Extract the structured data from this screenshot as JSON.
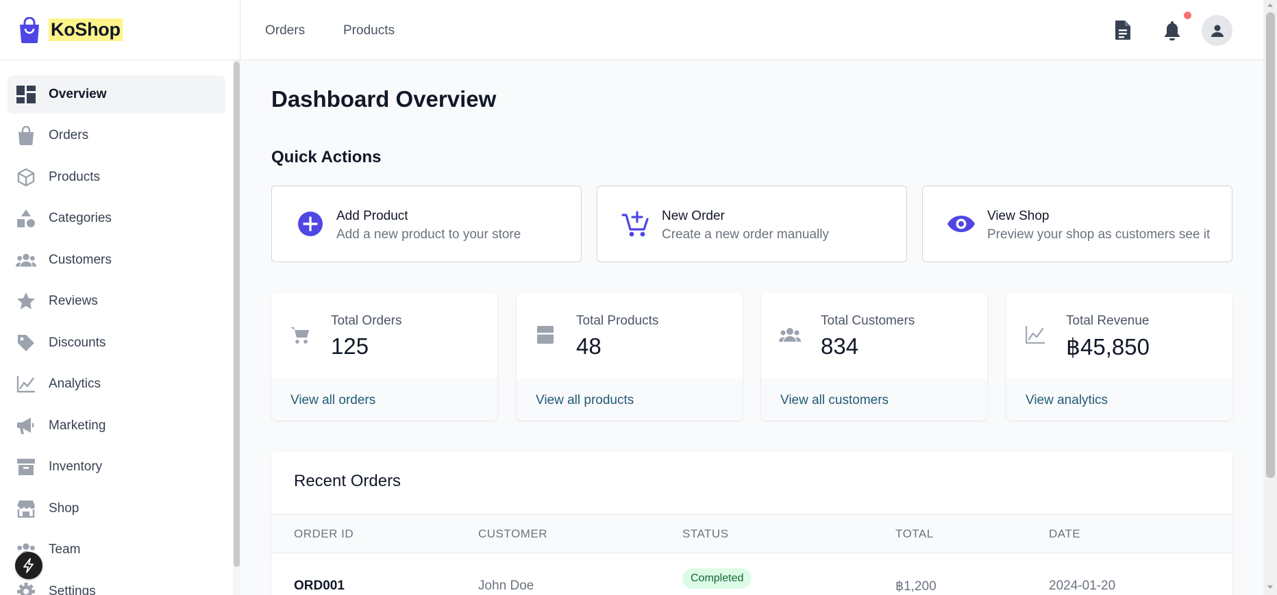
{
  "brand": {
    "name": "KoShop",
    "accent": "#4f46e5"
  },
  "sidebar": {
    "items": [
      {
        "label": "Overview",
        "icon": "dashboard-icon",
        "active": true
      },
      {
        "label": "Orders",
        "icon": "shopping-bag-icon"
      },
      {
        "label": "Products",
        "icon": "box-icon"
      },
      {
        "label": "Categories",
        "icon": "shapes-icon"
      },
      {
        "label": "Customers",
        "icon": "users-icon"
      },
      {
        "label": "Reviews",
        "icon": "star-icon"
      },
      {
        "label": "Discounts",
        "icon": "tag-icon"
      },
      {
        "label": "Analytics",
        "icon": "line-chart-icon"
      },
      {
        "label": "Marketing",
        "icon": "megaphone-icon"
      },
      {
        "label": "Inventory",
        "icon": "archive-icon"
      },
      {
        "label": "Shop",
        "icon": "storefront-icon"
      },
      {
        "label": "Team",
        "icon": "team-icon"
      },
      {
        "label": "Settings",
        "icon": "gear-icon"
      }
    ]
  },
  "header": {
    "links": [
      "Orders",
      "Products"
    ],
    "icons": [
      "document-icon",
      "bell-icon",
      "user-icon"
    ],
    "notification_color": "#f87171"
  },
  "main": {
    "title": "Dashboard Overview",
    "quick_actions_title": "Quick Actions",
    "quick_actions": [
      {
        "title": "Add Product",
        "desc": "Add a new product to your store",
        "icon": "plus-circle-icon"
      },
      {
        "title": "New Order",
        "desc": "Create a new order manually",
        "icon": "cart-plus-icon"
      },
      {
        "title": "View Shop",
        "desc": "Preview your shop as customers see it",
        "icon": "eye-icon"
      }
    ],
    "stats": [
      {
        "label": "Total Orders",
        "value": "125",
        "link": "View all orders",
        "icon": "cart-icon"
      },
      {
        "label": "Total Products",
        "value": "48",
        "link": "View all products",
        "icon": "product-box-icon"
      },
      {
        "label": "Total Customers",
        "value": "834",
        "link": "View all customers",
        "icon": "users-icon"
      },
      {
        "label": "Total Revenue",
        "value": "฿45,850",
        "link": "View analytics",
        "icon": "line-chart-icon"
      }
    ],
    "recent_orders": {
      "title": "Recent Orders",
      "columns": [
        "ORDER ID",
        "CUSTOMER",
        "STATUS",
        "TOTAL",
        "DATE"
      ],
      "rows": [
        {
          "id": "ORD001",
          "customer": "John Doe",
          "status": "Completed",
          "total": "฿1,200",
          "date": "2024-01-20"
        }
      ]
    }
  }
}
